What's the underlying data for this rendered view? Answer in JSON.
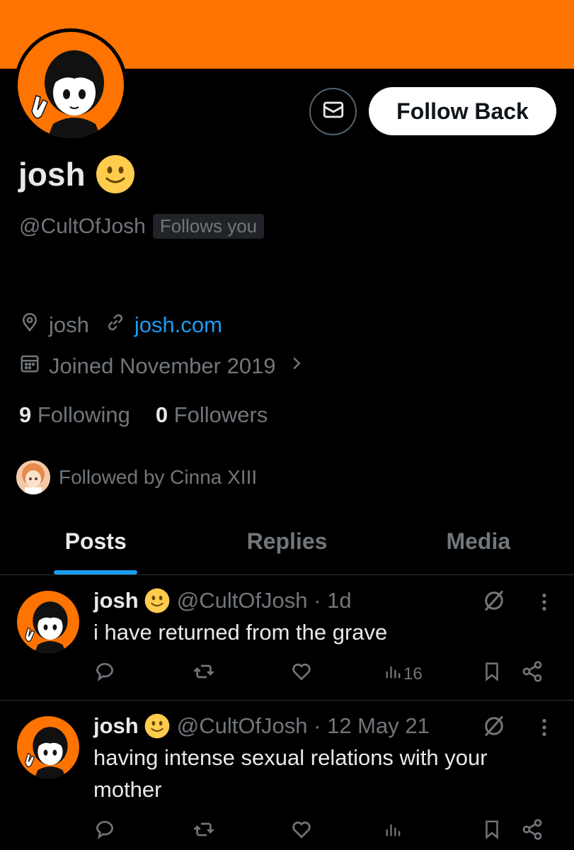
{
  "profile": {
    "display_name": "josh",
    "handle": "@CultOfJosh",
    "follows_you": "Follows you",
    "location": "josh",
    "website": "josh.com",
    "joined": "Joined November 2019",
    "following_count": "9",
    "following_label": "Following",
    "followers_count": "0",
    "followers_label": "Followers",
    "followed_by": "Followed by Cinna XIII",
    "follow_button": "Follow Back"
  },
  "colors": {
    "banner": "#ff7300",
    "link": "#1d9bf0",
    "muted": "#71767b",
    "text": "#e7e9ea"
  },
  "tabs": [
    {
      "label": "Posts",
      "active": true
    },
    {
      "label": "Replies",
      "active": false
    },
    {
      "label": "Media",
      "active": false
    }
  ],
  "posts": [
    {
      "name": "josh",
      "meta": "@CultOfJosh · 1d",
      "text": "i have returned from the grave",
      "views": "16"
    },
    {
      "name": "josh",
      "meta": "@CultOfJosh · 12 May 21",
      "text": "having intense sexual relations with your mother",
      "views": ""
    }
  ],
  "icons": {
    "message": "envelope-icon",
    "location": "location-pin-icon",
    "link": "link-icon",
    "calendar": "calendar-icon",
    "reply": "reply-icon",
    "repost": "repost-icon",
    "like": "heart-icon",
    "views": "views-icon",
    "bookmark": "bookmark-icon",
    "share": "share-icon",
    "grok": "grok-icon",
    "more": "more-icon"
  }
}
